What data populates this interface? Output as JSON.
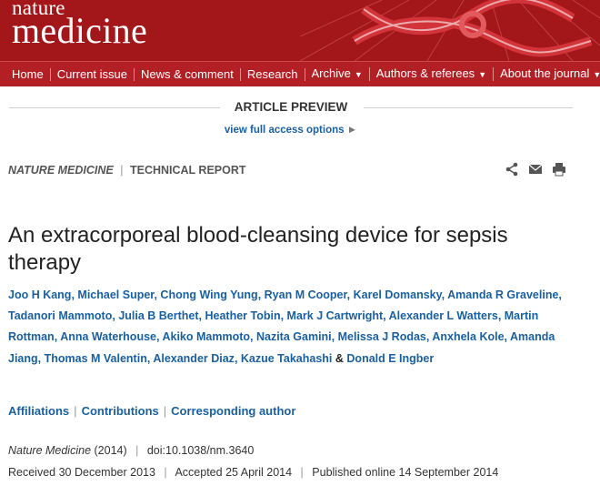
{
  "header": {
    "logo_small": "nature",
    "logo_big": "medicine",
    "brand_color": "#a3171b"
  },
  "nav": {
    "items": [
      {
        "label": "Home",
        "has_dropdown": false
      },
      {
        "label": "Current issue",
        "has_dropdown": false
      },
      {
        "label": "News & comment",
        "has_dropdown": false
      },
      {
        "label": "Research",
        "has_dropdown": false
      },
      {
        "label": "Archive",
        "has_dropdown": true
      },
      {
        "label": "Authors & referees",
        "has_dropdown": true
      },
      {
        "label": "About the journal",
        "has_dropdown": true
      }
    ]
  },
  "preview": {
    "label": "ARTICLE PREVIEW",
    "access_link": "view full access options",
    "access_arrow": "►"
  },
  "article": {
    "journal": "NATURE MEDICINE",
    "type": "TECHNICAL REPORT",
    "title": "An extracorporeal blood-cleansing device for sepsis therapy",
    "authors": [
      "Joo H Kang",
      "Michael Super",
      "Chong Wing Yung",
      "Ryan M Cooper",
      "Karel Domansky",
      "Amanda R Graveline",
      "Tadanori Mammoto",
      "Julia B Berthet",
      "Heather Tobin",
      "Mark J Cartwright",
      "Alexander L Watters",
      "Martin Rottman",
      "Anna Waterhouse",
      "Akiko Mammoto",
      "Nazita Gamini",
      "Melissa J Rodas",
      "Anxhela Kole",
      "Amanda Jiang",
      "Thomas M Valentin",
      "Alexander Diaz",
      "Kazue Takahashi",
      "Donald E Ingber"
    ],
    "links": [
      "Affiliations",
      "Contributions",
      "Corresponding author"
    ],
    "citation": {
      "journal": "Nature Medicine",
      "year": "(2014)",
      "doi": "doi:10.1038/nm.3640"
    },
    "dates": {
      "received_label": "Received",
      "received": "30 December 2013",
      "accepted_label": "Accepted",
      "accepted": "25 April 2014",
      "published_label": "Published online",
      "published": "14 September 2014"
    }
  },
  "icons": [
    "share-icon",
    "email-icon",
    "print-icon"
  ]
}
